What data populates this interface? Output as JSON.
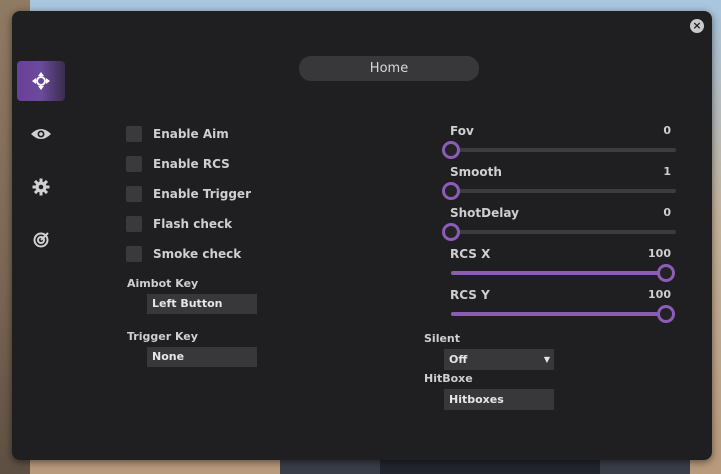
{
  "header": {
    "title": "Home"
  },
  "window": {
    "close_glyph": "×"
  },
  "sidebar": {
    "items": [
      {
        "icon": "move-crosshair-icon",
        "active": true
      },
      {
        "icon": "eye-icon",
        "active": false
      },
      {
        "icon": "gear-icon",
        "active": false
      },
      {
        "icon": "target-icon",
        "active": false
      }
    ]
  },
  "checkboxes": [
    {
      "label": "Enable Aim",
      "checked": false
    },
    {
      "label": "Enable RCS",
      "checked": false
    },
    {
      "label": "Enable Trigger",
      "checked": false
    },
    {
      "label": "Flash check",
      "checked": false
    },
    {
      "label": "Smoke check",
      "checked": false
    }
  ],
  "aimbot_key": {
    "label": "Aimbot Key",
    "value": "Left Button"
  },
  "trigger_key": {
    "label": "Trigger Key",
    "value": "None"
  },
  "sliders": [
    {
      "label": "Fov",
      "value": "0",
      "fraction": 0.0
    },
    {
      "label": "Smooth",
      "value": "1",
      "fraction": 0.0
    },
    {
      "label": "ShotDelay",
      "value": "0",
      "fraction": 0.0
    },
    {
      "label": "RCS X",
      "value": "100",
      "fraction": 1.0
    },
    {
      "label": "RCS Y",
      "value": "100",
      "fraction": 1.0
    }
  ],
  "silent": {
    "label": "Silent",
    "value": "Off",
    "arrow": "▼"
  },
  "hitboxe": {
    "label": "HitBoxe",
    "value": "Hitboxes"
  },
  "colors": {
    "accent": "#8b5cb8",
    "panel": "#1f1f21",
    "control": "#38383b"
  }
}
